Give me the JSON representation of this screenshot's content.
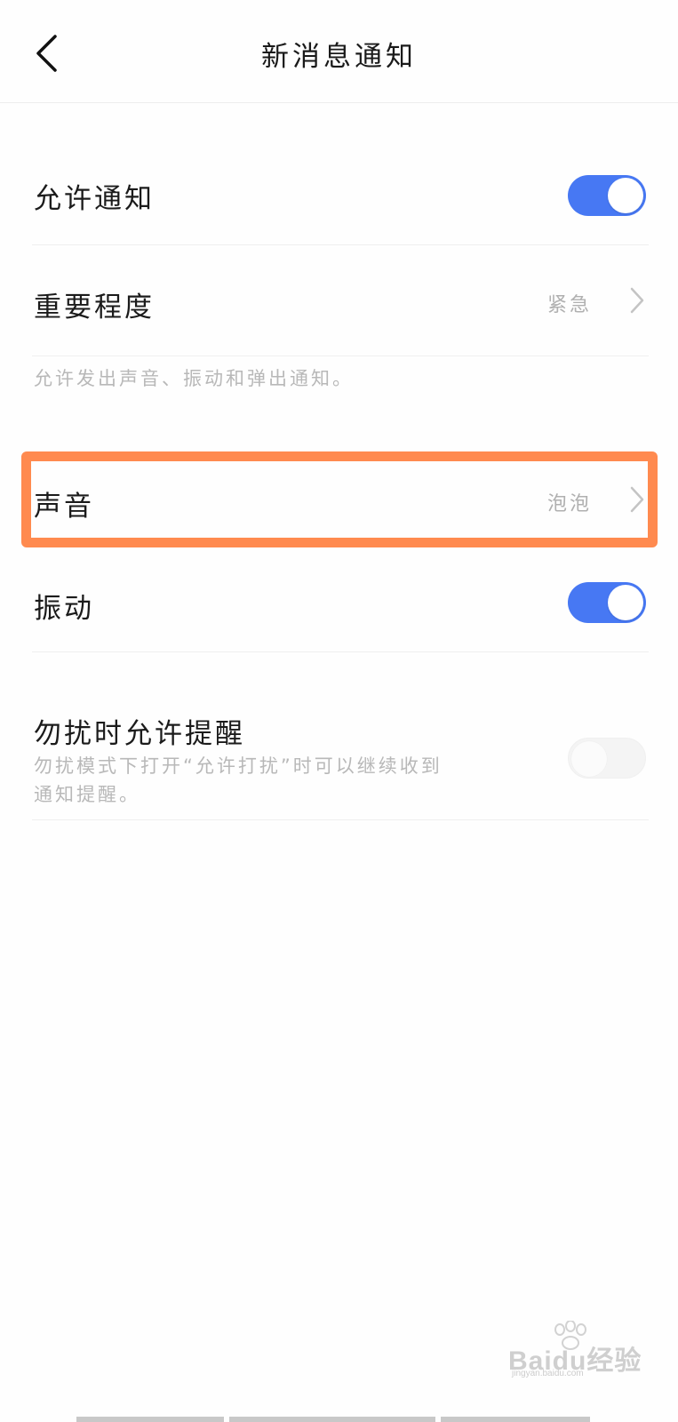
{
  "header": {
    "title": "新消息通知",
    "back_icon": "chevron-left-icon"
  },
  "settings": {
    "allow_notifications": {
      "label": "允许通知",
      "enabled": true
    },
    "importance": {
      "label": "重要程度",
      "value": "紧急",
      "icon": "chevron-right-icon"
    },
    "importance_desc": "允许发出声音、振动和弹出通知。",
    "sound": {
      "label": "声音",
      "value": "泡泡",
      "icon": "chevron-right-icon"
    },
    "vibration": {
      "label": "振动",
      "enabled": true
    },
    "dnd_reminder": {
      "label": "勿扰时允许提醒",
      "desc_line1": "勿扰模式下打开“允许打扰”时可以继续收到",
      "desc_line2": "通知提醒。",
      "enabled": false
    }
  },
  "colors": {
    "toggle_on": "#4778f3",
    "highlight": "#ff8a4f",
    "secondary_text": "#b0b0b0"
  },
  "watermark": {
    "text": "Baidu经验",
    "sub": "jingyan.baidu.com"
  }
}
